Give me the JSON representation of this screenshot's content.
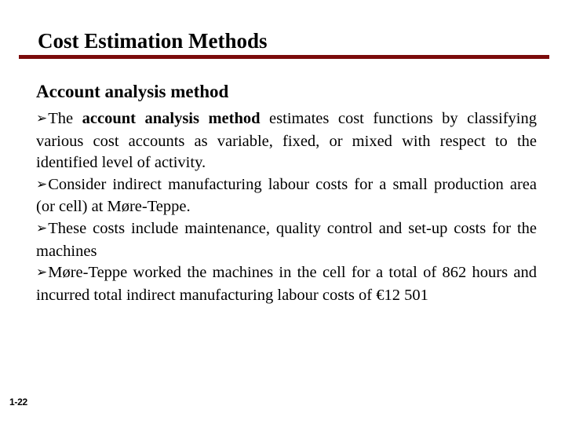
{
  "slide": {
    "title": "Cost Estimation Methods",
    "subheading": "Account analysis method",
    "accent_color": "#7b0b0b",
    "text_color": "#000000",
    "background_color": "#ffffff",
    "page_number": "1-22",
    "bullet_glyph": "➢",
    "bullets": [
      {
        "lead": "The ",
        "bold": "account analysis method",
        "rest": " estimates cost functions by classifying various cost accounts as variable, fixed, or mixed with respect to the identified level of activity."
      },
      {
        "lead": "Consider indirect manufacturing labour costs for a small production area (or cell) at Møre-Teppe.",
        "bold": "",
        "rest": ""
      },
      {
        "lead": "These costs include maintenance, quality control and set-up costs for the machines",
        "bold": "",
        "rest": ""
      },
      {
        "lead": "Møre-Teppe worked the machines in the cell for a total of 862 hours and incurred total indirect manufacturing labour costs of €12 501",
        "bold": "",
        "rest": ""
      }
    ]
  }
}
